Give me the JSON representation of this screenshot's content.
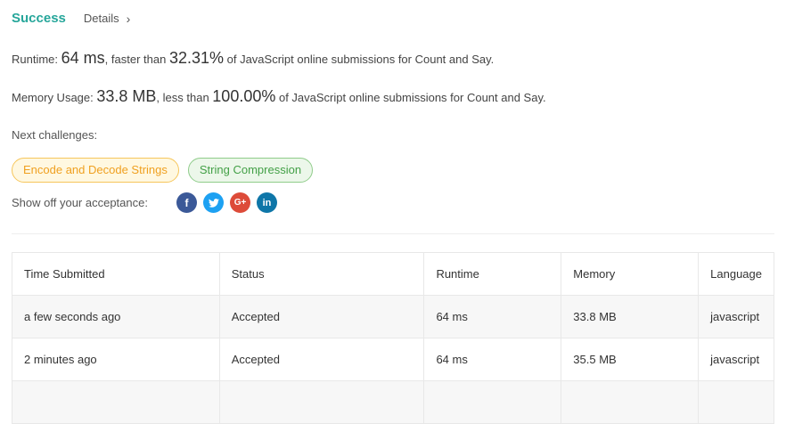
{
  "header": {
    "status": "Success",
    "details_label": "Details",
    "details_chevron": "›"
  },
  "runtime": {
    "label": "Runtime: ",
    "value": "64 ms",
    "mid": ", faster than ",
    "percent": "32.31%",
    "suffix": " of JavaScript online submissions for Count and Say."
  },
  "memory": {
    "label": "Memory Usage: ",
    "value": "33.8 MB",
    "mid": ", less than ",
    "percent": "100.00%",
    "suffix": " of JavaScript online submissions for Count and Say."
  },
  "next_challenges": {
    "label": "Next challenges:",
    "items": [
      {
        "label": "Encode and Decode Strings",
        "color": "#f0a020"
      },
      {
        "label": "String Compression",
        "color": "#43a047"
      }
    ]
  },
  "share": {
    "label": "Show off your acceptance:",
    "icons": [
      {
        "name": "facebook-icon",
        "glyph": "f"
      },
      {
        "name": "twitter-icon",
        "glyph": "t"
      },
      {
        "name": "google-plus-icon",
        "glyph": "G+"
      },
      {
        "name": "linkedin-icon",
        "glyph": "in"
      }
    ]
  },
  "table": {
    "headers": [
      "Time Submitted",
      "Status",
      "Runtime",
      "Memory",
      "Language"
    ],
    "rows": [
      [
        "a few seconds ago",
        "Accepted",
        "64 ms",
        "33.8 MB",
        "javascript"
      ],
      [
        "2 minutes ago",
        "Accepted",
        "64 ms",
        "35.5 MB",
        "javascript"
      ],
      [
        "",
        "",
        "",
        "",
        ""
      ]
    ]
  },
  "colors": {
    "accent": "#26a69a",
    "medium": "#f0a020",
    "easy": "#43a047"
  }
}
